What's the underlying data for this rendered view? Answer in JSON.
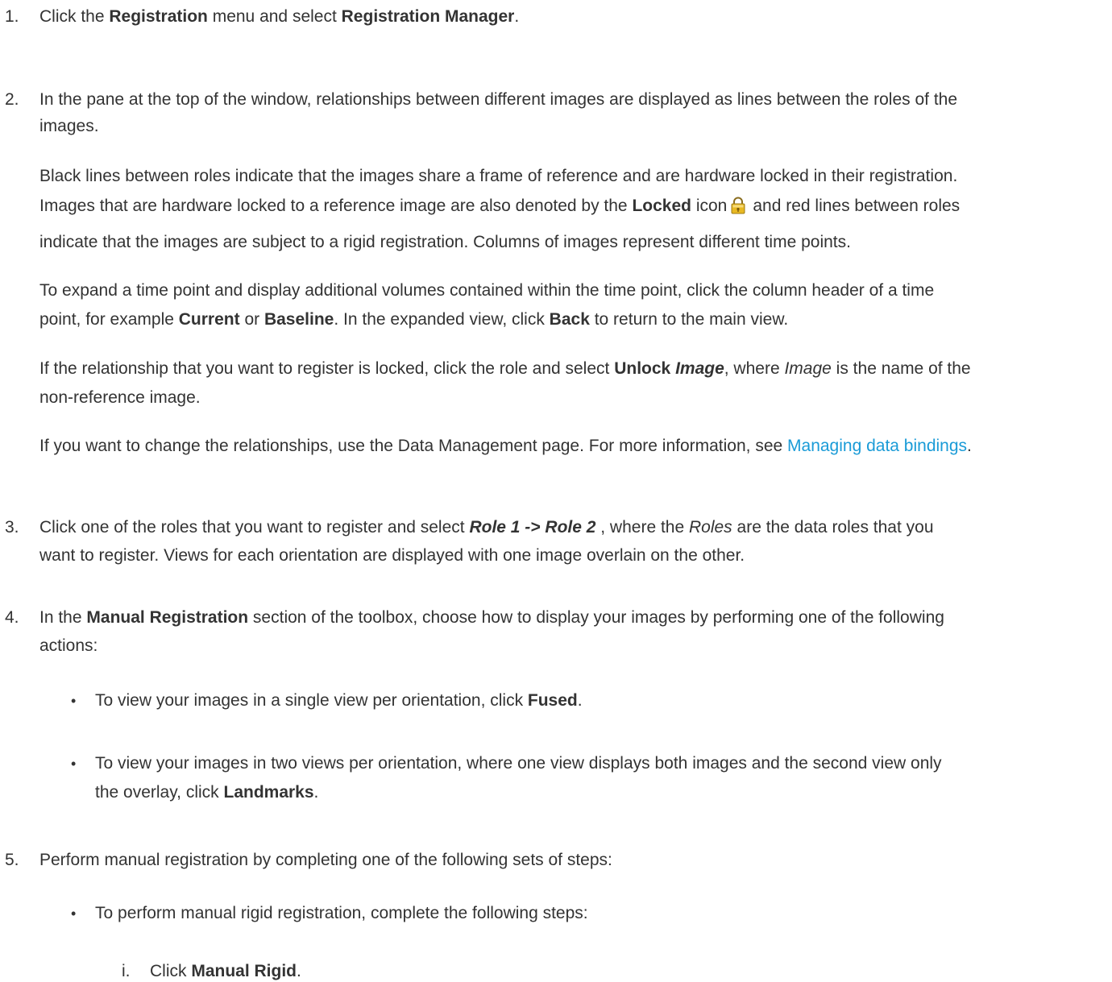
{
  "steps": [
    {
      "number": "1.",
      "text": {
        "a": "Click the ",
        "b": "Registration",
        "c": " menu and select ",
        "d": "Registration Manager",
        "e": "."
      }
    },
    {
      "number": "2.",
      "intro_line1": "In the pane at the top of the window, relationships between different images are displayed as lines between the roles of the",
      "intro_line2": "images.",
      "p1_line1": "Black lines between roles indicate that the images share a frame of reference and are hardware locked in their registration.",
      "p1_line2": {
        "a": "Images that are hardware locked to a reference image are also denoted by the ",
        "b": "Locked",
        "c": " icon",
        "d": "and red lines between roles"
      },
      "p1_line3": "indicate that the images are subject to a rigid registration. Columns of images represent different time points.",
      "p2_line1": "To expand a time point and display additional volumes contained within the time point, click the column header of a time",
      "p2_line2": {
        "a": "point, for example ",
        "b": "Current",
        "c": " or ",
        "d": "Baseline",
        "e": ". In the expanded view, click ",
        "f": "Back",
        "g": " to return to the main view."
      },
      "p3_line1": {
        "a": "If the relationship that you want to register is locked, click the role and select ",
        "b": "Unlock ",
        "c": "Image",
        "d": ", where ",
        "e": "Image",
        "f": " is the name of the"
      },
      "p3_line2": "non-reference image.",
      "p4_line1": {
        "a": "If you want to change the relationships, use the Data Management page. For more information, see ",
        "link": "Managing data bindings",
        "b": "."
      }
    },
    {
      "number": "3.",
      "line1": {
        "a": "Click one of the roles that you want to register and select ",
        "b": "Role 1 -> Role 2",
        "c": " , where the ",
        "d": "Roles",
        "e": " are the data roles that you"
      },
      "line2": "want to register. Views for each orientation are displayed with one image overlain on the other."
    },
    {
      "number": "4.",
      "line1": {
        "a": "In the ",
        "b": "Manual Registration",
        "c": " section of the toolbox, choose how to display your images by performing one of the following"
      },
      "line2": "actions:",
      "bullets": [
        {
          "mark": "•",
          "line1": {
            "a": "To view your images in a single view per orientation, click ",
            "b": "Fused",
            "c": "."
          }
        },
        {
          "mark": "•",
          "line1": "To view your images in two views per orientation, where one view displays both images and the second view only",
          "line2": {
            "a": "the overlay, click ",
            "b": "Landmarks",
            "c": "."
          }
        }
      ]
    },
    {
      "number": "5.",
      "line1": "Perform manual registration by completing one of the following sets of steps:",
      "bullets": [
        {
          "mark": "•",
          "line1": "To perform manual rigid registration, complete the following steps:",
          "substeps": [
            {
              "number": "i.",
              "a": "Click ",
              "b": "Manual Rigid",
              "c": "."
            }
          ]
        }
      ]
    }
  ],
  "icons": {
    "locked": "lock-icon",
    "lock_color": "#e8b923"
  }
}
